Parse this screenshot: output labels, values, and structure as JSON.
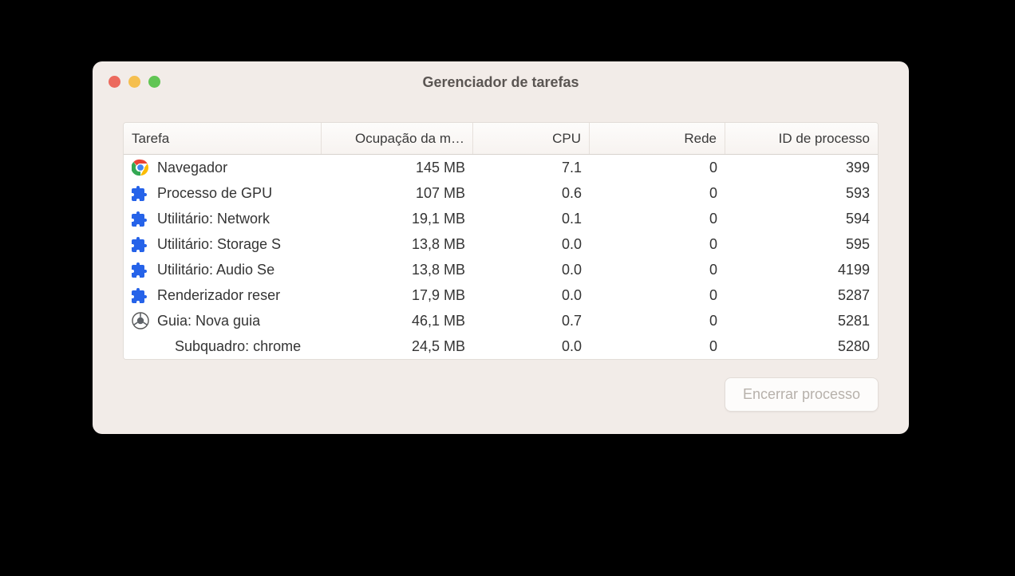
{
  "window": {
    "title": "Gerenciador de tarefas"
  },
  "columns": {
    "task": "Tarefa",
    "memory": "Ocupação da m…",
    "cpu": "CPU",
    "network": "Rede",
    "pid": "ID de processo"
  },
  "rows": [
    {
      "icon": "chrome",
      "task": "Navegador",
      "memory": "145 MB",
      "cpu": "7.1",
      "network": "0",
      "pid": "399"
    },
    {
      "icon": "extension",
      "task": "Processo de GPU",
      "memory": "107 MB",
      "cpu": "0.6",
      "network": "0",
      "pid": "593"
    },
    {
      "icon": "extension",
      "task": "Utilitário: Network",
      "memory": "19,1 MB",
      "cpu": "0.1",
      "network": "0",
      "pid": "594"
    },
    {
      "icon": "extension",
      "task": "Utilitário: Storage S",
      "memory": "13,8 MB",
      "cpu": "0.0",
      "network": "0",
      "pid": "595"
    },
    {
      "icon": "extension",
      "task": "Utilitário: Audio Se",
      "memory": "13,8 MB",
      "cpu": "0.0",
      "network": "0",
      "pid": "4199"
    },
    {
      "icon": "extension",
      "task": "Renderizador reser",
      "memory": "17,9 MB",
      "cpu": "0.0",
      "network": "0",
      "pid": "5287"
    },
    {
      "icon": "chromium",
      "task": "Guia: Nova guia",
      "memory": "46,1 MB",
      "cpu": "0.7",
      "network": "0",
      "pid": "5281"
    },
    {
      "icon": "none",
      "indent": true,
      "task": "Subquadro: chrome",
      "memory": "24,5 MB",
      "cpu": "0.0",
      "network": "0",
      "pid": "5280"
    }
  ],
  "footer": {
    "end_process": "Encerrar processo"
  }
}
